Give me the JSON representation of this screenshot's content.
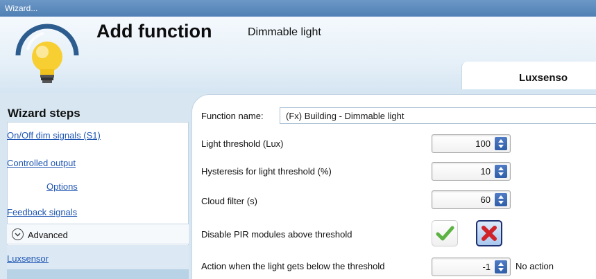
{
  "window": {
    "title": "Wizard..."
  },
  "header": {
    "title": "Add function",
    "subtitle": "Dimmable light",
    "tab_label": "Luxsenso"
  },
  "sidebar": {
    "title": "Wizard steps",
    "items": [
      {
        "label": "On/Off dim signals (S1)"
      },
      {
        "label": "Controlled output"
      },
      {
        "label": "Options"
      },
      {
        "label": "Feedback signals"
      },
      {
        "label": "Advanced"
      },
      {
        "label": "Luxsensor"
      }
    ]
  },
  "form": {
    "function_name_label": "Function name:",
    "function_name_value": "(Fx) Building - Dimmable light",
    "light_threshold_label": "Light threshold (Lux)",
    "light_threshold_value": "100",
    "hysteresis_label": "Hysteresis for light threshold (%)",
    "hysteresis_value": "10",
    "cloud_filter_label": "Cloud filter (s)",
    "cloud_filter_value": "60",
    "disable_pir_label": "Disable PIR modules above threshold",
    "action_label": "Action when the light gets below the threshold",
    "action_value": "-1",
    "action_note": "No action"
  },
  "colors": {
    "title_bar": "#5a88bd",
    "link": "#1f56b3",
    "accent_blue": "#2f5ea8",
    "check_green": "#5cb343",
    "cross_red": "#d0232a"
  }
}
